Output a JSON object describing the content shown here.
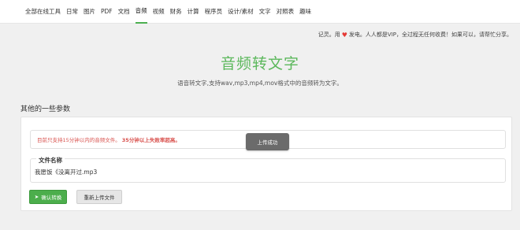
{
  "nav": {
    "items": [
      {
        "label": "全部在线工具",
        "active": false
      },
      {
        "label": "日常",
        "active": false
      },
      {
        "label": "图片",
        "active": false
      },
      {
        "label": "PDF",
        "active": false
      },
      {
        "label": "文档",
        "active": false
      },
      {
        "label": "音频",
        "active": true
      },
      {
        "label": "视频",
        "active": false
      },
      {
        "label": "财务",
        "active": false
      },
      {
        "label": "计算",
        "active": false
      },
      {
        "label": "程序员",
        "active": false
      },
      {
        "label": "设计/素材",
        "active": false
      },
      {
        "label": "文字",
        "active": false
      },
      {
        "label": "对照表",
        "active": false
      },
      {
        "label": "趣味",
        "active": false
      }
    ]
  },
  "notice": {
    "prefix": "记灵。用",
    "heart": "♥",
    "suffix": "发电。人人都是VIP，全过程无任何收费！如果可以，请帮忙分享。"
  },
  "hero": {
    "title": "音频转文字",
    "subtitle": "语音转文字,支持wav,mp3,mp4,mov格式中的音频转为文字。"
  },
  "params": {
    "section_title": "其他的一些参数",
    "alert_text": "目前只支持15分钟以内的音频文件。",
    "alert_strong": "35分钟以上失败率超高。",
    "toast": "上传成功",
    "file_legend": "文件名称",
    "file_name": "我愿饭《没离开过.mp3",
    "confirm_label": "确认转换",
    "confirm_icon": "➤",
    "reupload_label": "重新上传文件"
  },
  "colors": {
    "accent": "#5cb85c",
    "warning": "#d9534f",
    "heart": "#e53935"
  }
}
